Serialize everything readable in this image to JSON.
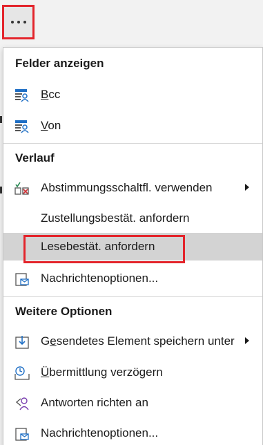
{
  "more_button": {
    "icon": "more-horizontal-icon"
  },
  "sections": {
    "show_fields": {
      "header": "Felder anzeigen"
    },
    "tracking": {
      "header": "Verlauf"
    },
    "more_options": {
      "header": "Weitere Optionen"
    }
  },
  "items": {
    "bcc": {
      "accel": "B",
      "rest": "cc",
      "icon": "bcc-field-icon"
    },
    "from": {
      "accel": "V",
      "rest": "on",
      "icon": "from-field-icon"
    },
    "voting": {
      "label": "Abstimmungsschaltfl. verwenden",
      "icon": "voting-buttons-icon"
    },
    "delivery_receipt": {
      "label": "Zustellungsbestät. anfordern"
    },
    "read_receipt": {
      "label": "Lesebestät. anfordern"
    },
    "message_options_1": {
      "label": "Nachrichtenoptionen...",
      "icon": "message-options-icon"
    },
    "save_sent": {
      "pre": "G",
      "accel": "e",
      "rest": "sendetes Element speichern unter",
      "icon": "save-sent-item-icon"
    },
    "delay_delivery": {
      "pre": "",
      "accel": "Ü",
      "rest": "bermittlung verzögern",
      "icon": "delay-delivery-icon"
    },
    "direct_replies": {
      "label": "Antworten richten an",
      "icon": "direct-replies-icon"
    },
    "message_options_2": {
      "label": "Nachrichtenoptionen...",
      "icon": "message-options-icon"
    }
  },
  "colors": {
    "highlight_border": "#e3242b",
    "selected_row": "#d3d3d3",
    "icon_blue": "#1f6fc5"
  }
}
